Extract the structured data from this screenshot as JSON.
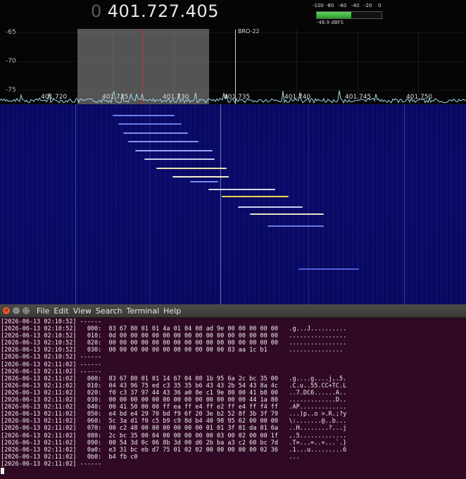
{
  "spectrum": {
    "frequency_prefix": "0",
    "frequency": "401.727.405",
    "meter": {
      "ticks": [
        "-100",
        "-80",
        "-60",
        "-40",
        "-20",
        "0"
      ],
      "level_label": "-46.9 dBFS",
      "level_fraction": 0.53
    },
    "y_labels": [
      "-65",
      "-70",
      "-75"
    ],
    "x_labels": [
      "401.720",
      "401.725",
      "401.730",
      "401.735",
      "401.740",
      "401.745",
      "401.750"
    ],
    "bookmark_label": "BRO-22",
    "colors": {
      "filter_band": "#969696",
      "center_line": "#c23b3b",
      "trace": "#9fd8e8",
      "waterfall_bg": "#0a0a6e"
    }
  },
  "terminal": {
    "menu": [
      "File",
      "Edit",
      "View",
      "Search",
      "Terminal",
      "Help"
    ],
    "lines": [
      "[2026-06-13 02:10:52] ------",
      "[2026-06-13 02:10:52]   000:  83 67 80 01 01 4a 01 04 08 ad 9e 00 00 00 00 00   .g...J..........",
      "[2026-06-13 02:10:52]   010:  0d 00 00 00 00 00 00 00 00 00 00 00 00 00 00 00   ................",
      "[2026-06-13 02:10:52]   020:  00 00 00 00 00 00 00 00 00 00 00 00 00 00 00 00   ................",
      "[2026-06-13 02:10:52]   030:  00 00 00 00 00 00 00 00 00 00 00 83 aa 1c b1      ...............",
      "[2026-06-13 02:10:52] ------",
      "[2026-06-13 02:11:02] ------",
      "[2026-06-13 02:11:02] ------",
      "[2026-06-13 02:11:02]   000:  83 67 80 01 01 14 67 04 08 1b 95 6a 2c bc 35 00   .g....g....j,.5.",
      "[2026-06-13 02:11:02]   010:  04 43 96 75 ed c3 35 35 b6 43 43 2b 54 43 8a 4c   .C.u..55.CC+TC.L",
      "[2026-06-13 02:11:02]   020:  f0 c3 37 97 44 43 36 a0 8e c1 9e 80 00 41 b8 00   ..7.DC6......A..",
      "[2026-06-13 02:11:02]   030:  00 00 00 00 00 00 00 00 00 00 00 00 00 44 1a 80   .............D..",
      "[2026-06-13 02:11:02]   040:  00 41 50 00 00 ff ea ff e4 ff e2 ff e4 ff f4 ff   .AP.............",
      "[2026-06-13 02:11:02]   050:  e4 bd e4 29 70 bd f9 6f 20 3e b2 52 8f 3b 3f 79   ...)p..o >.R.;?y",
      "[2026-06-13 02:11:02]   060:  5c 3a d1 f0 c5 b9 c9 8d b4 40 98 95 62 00 00 00   \\:.......@..b...",
      "[2026-06-13 02:11:02]   070:  00 c2 48 00 00 00 00 00 00 01 01 3f 01 da 81 6a   ..H........?...j",
      "[2026-06-13 02:11:02]   080:  2c bc 35 00 04 00 00 00 00 00 03 00 02 00 00 1f   ,.5.............",
      "[2026-06-13 02:11:02]   090:  00 54 3d 0c 06 8b 3d 00 d6 2b ba a3 c2 60 bc 7d   .T=...=..+...`.}",
      "[2026-06-13 02:11:02]   0a0:  e3 31 bc eb d7 75 01 02 02 00 00 00 00 00 02 36   .1...u.........6",
      "[2026-06-13 02:11:02]   0b0:  b4 fb c0                                          ...",
      "[2026-06-13 02:11:02] ------"
    ]
  }
}
